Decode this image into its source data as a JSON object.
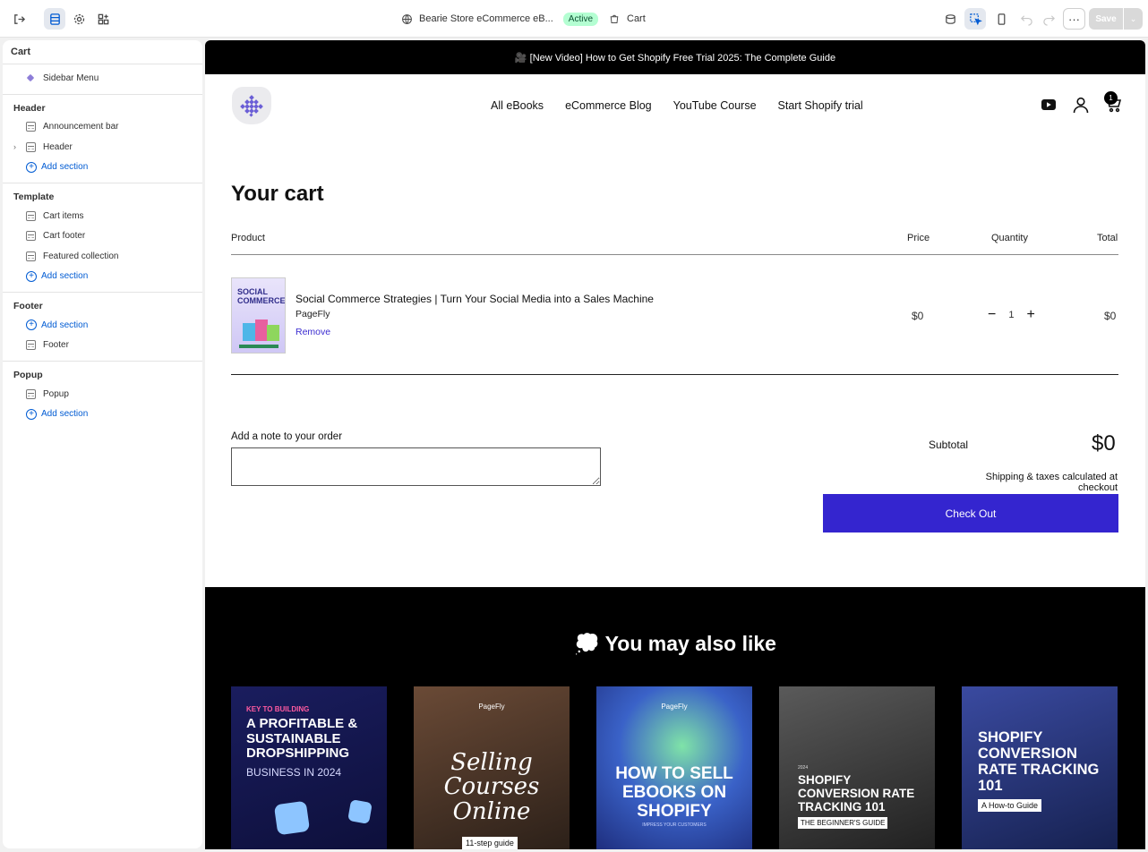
{
  "topbar": {
    "store_name": "Bearie Store eCommerce eB...",
    "status_badge": "Active",
    "page_name": "Cart",
    "save_label": "Save",
    "more_label": "···"
  },
  "sidebar": {
    "title": "Cart",
    "top_item": "Sidebar Menu",
    "groups": {
      "header": {
        "title": "Header",
        "items": [
          "Announcement bar",
          "Header"
        ],
        "add": "Add section"
      },
      "template": {
        "title": "Template",
        "items": [
          "Cart items",
          "Cart footer",
          "Featured collection"
        ],
        "add": "Add section"
      },
      "footer": {
        "title": "Footer",
        "add": "Add section",
        "items": [
          "Footer"
        ]
      },
      "popup": {
        "title": "Popup",
        "items": [
          "Popup"
        ],
        "add": "Add section"
      }
    }
  },
  "store": {
    "announcement": "🎥 [New Video] How to Get Shopify Free Trial 2025: The Complete Guide",
    "nav": [
      "All eBooks",
      "eCommerce Blog",
      "YouTube Course",
      "Start Shopify trial"
    ],
    "cart_count": "1",
    "cart_title": "Your cart",
    "columns": {
      "product": "Product",
      "price": "Price",
      "quantity": "Quantity",
      "total": "Total"
    },
    "item": {
      "name": "Social Commerce Strategies | Turn Your Social Media into a Sales Machine",
      "vendor": "PageFly",
      "remove": "Remove",
      "price": "$0",
      "quantity": "1",
      "total": "$0",
      "thumb_text": "SOCIAL COMMERCE"
    },
    "note_label": "Add a note to your order",
    "subtotal_label": "Subtotal",
    "subtotal_value": "$0",
    "shipping_note": "Shipping & taxes calculated at checkout",
    "checkout_label": "Check Out",
    "also_title": "💭 You may also like",
    "cards": {
      "c1": {
        "kicker": "KEY TO BUILDING",
        "main": "A PROFITABLE & SUSTAINABLE DROPSHIPPING",
        "sub": "BUSINESS IN 2024"
      },
      "c2": {
        "brand": "PageFly",
        "main": "Selling Courses Online",
        "tag": "11-step guide"
      },
      "c3": {
        "brand": "PageFly",
        "main": "HOW TO SELL EBOOKS ON SHOPIFY",
        "sub": "IMPRESS YOUR CUSTOMERS"
      },
      "c4": {
        "year": "2024",
        "main": "SHOPIFY CONVERSION RATE TRACKING 101",
        "tag": "THE BEGINNER'S GUIDE"
      },
      "c5": {
        "main": "SHOPIFY CONVERSION RATE TRACKING 101",
        "tag": "A How-to Guide"
      }
    }
  }
}
